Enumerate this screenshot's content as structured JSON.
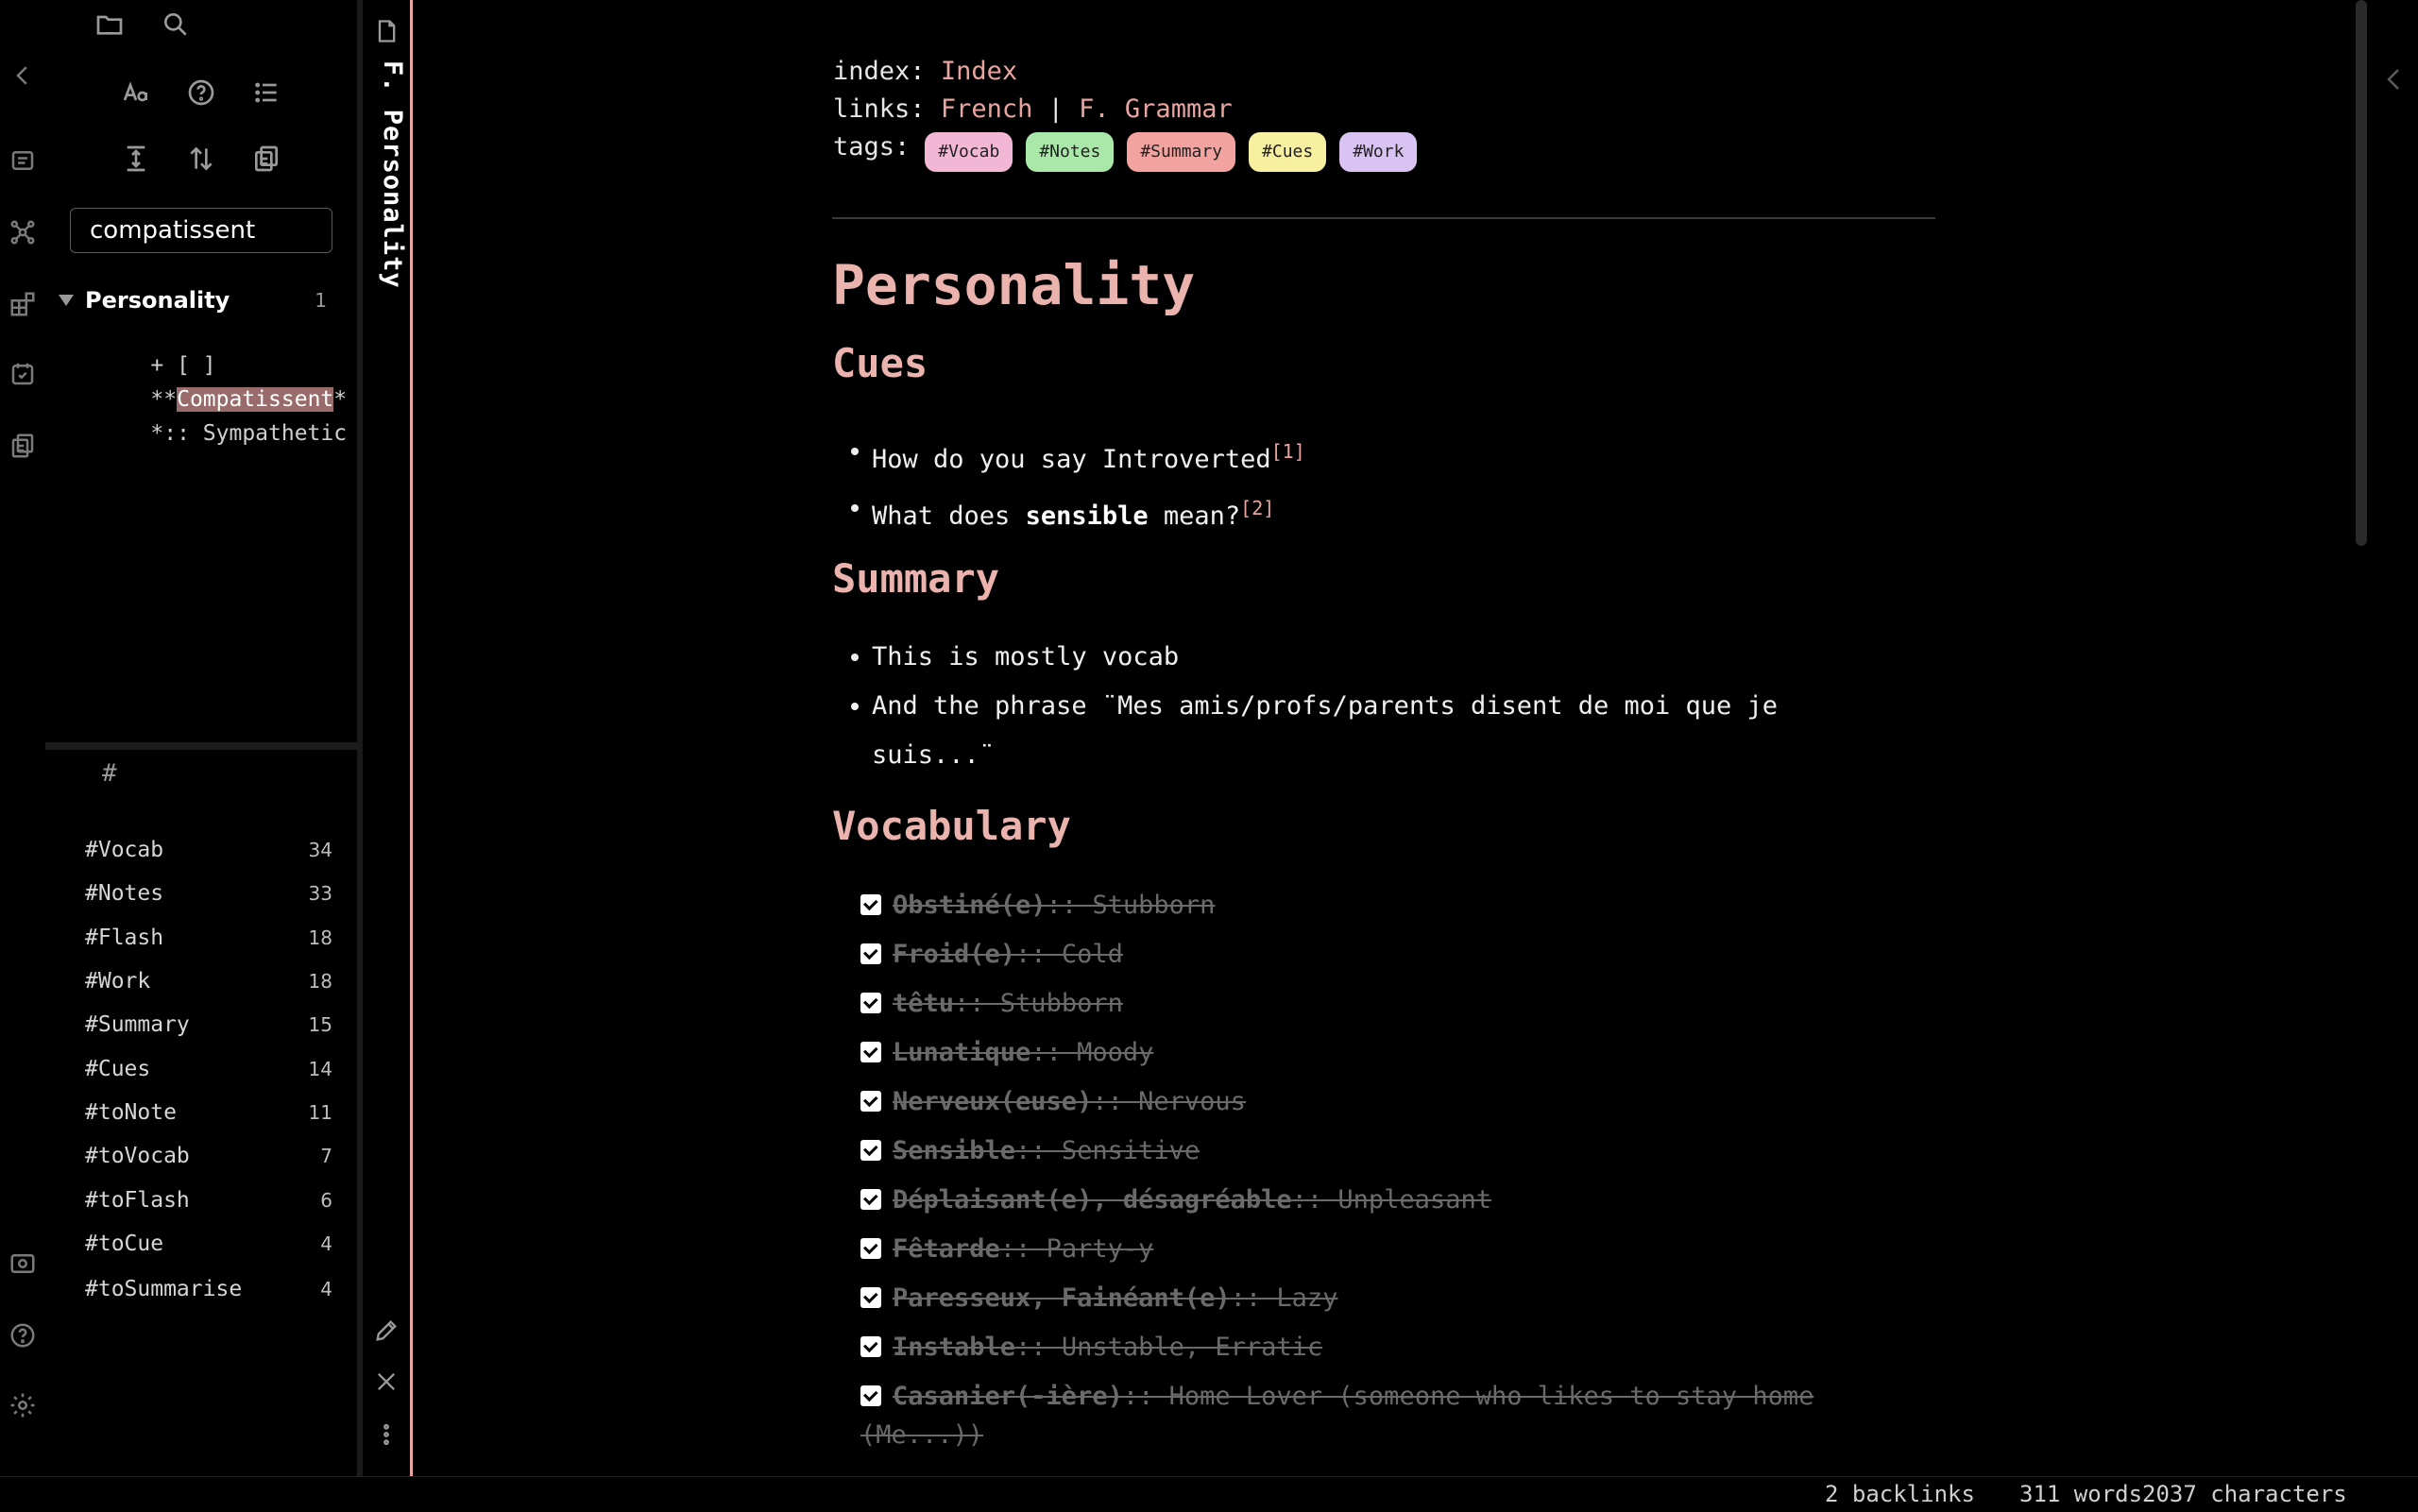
{
  "ribbon": {
    "icons": [
      "chevron-left-icon",
      "quick-switcher-icon",
      "graph-view-icon",
      "canvas-icon",
      "daily-note-icon",
      "templates-icon",
      "vault-icon",
      "help-icon",
      "settings-icon"
    ]
  },
  "sidebar": {
    "toolbar_icons": [
      "folder-icon",
      "search-icon",
      "match-case-icon",
      "help-icon",
      "list-icon",
      "expand-icon",
      "sort-icon",
      "copy-results-icon"
    ],
    "search": {
      "value": "compatissent"
    },
    "result": {
      "file": "Personality",
      "count": "1",
      "lines": [
        {
          "pre": "+ [ ]",
          "hl": "",
          "post": ""
        },
        {
          "pre": "**",
          "hl": "Compatissent",
          "post": "*"
        },
        {
          "pre": "*:: Sympathetic",
          "hl": "",
          "post": ""
        }
      ]
    },
    "tags_header": "#",
    "tags": [
      {
        "name": "#Vocab",
        "count": "34"
      },
      {
        "name": "#Notes",
        "count": "33"
      },
      {
        "name": "#Flash",
        "count": "18"
      },
      {
        "name": "#Work",
        "count": "18"
      },
      {
        "name": "#Summary",
        "count": "15"
      },
      {
        "name": "#Cues",
        "count": "14"
      },
      {
        "name": "#toNote",
        "count": "11"
      },
      {
        "name": "#toVocab",
        "count": "7"
      },
      {
        "name": "#toFlash",
        "count": "6"
      },
      {
        "name": "#toCue",
        "count": "4"
      },
      {
        "name": "#toSummarise",
        "count": "4"
      }
    ]
  },
  "tab": {
    "title": "F. Personality"
  },
  "frontmatter": {
    "index_label": "index:",
    "index_value": "Index",
    "links_label": "links:",
    "links": [
      "French",
      "F. Grammar"
    ],
    "links_sep": "|",
    "tags_label": "tags:",
    "tags": [
      {
        "label": "#Vocab",
        "color": "#f3b7d6"
      },
      {
        "label": "#Notes",
        "color": "#a9e8a8"
      },
      {
        "label": "#Summary",
        "color": "#f2a3a0"
      },
      {
        "label": "#Cues",
        "color": "#f6f0a0"
      },
      {
        "label": "#Work",
        "color": "#d9c3f3"
      }
    ]
  },
  "note": {
    "title": "Personality",
    "cues_heading": "Cues",
    "cues": [
      {
        "pre": "How do you say Introverted",
        "bold": "",
        "post": "",
        "ref": "[1]"
      },
      {
        "pre": "What does ",
        "bold": "sensible",
        "post": " mean?",
        "ref": "[2]"
      }
    ],
    "summary_heading": "Summary",
    "summary": [
      "This is mostly vocab",
      "And the phrase ¨Mes amis/profs/parents disent de moi que je",
      "suis...¨"
    ],
    "vocab_heading": "Vocabulary",
    "vocab": [
      {
        "term": "Obstiné(e)",
        "def": ":: Stubborn"
      },
      {
        "term": "Froid(e)",
        "def": ":: Cold"
      },
      {
        "term": "têtu",
        "def": ":: Stubborn"
      },
      {
        "term": "Lunatique",
        "def": ":: Moody"
      },
      {
        "term": "Nerveux(euse)",
        "def": ":: Nervous"
      },
      {
        "term": "Sensible",
        "def": ":: Sensitive"
      },
      {
        "term": "Déplaisant(e), désagréable",
        "def": ":: Unpleasant"
      },
      {
        "term": "Fêtarde",
        "def": ":: Party-y"
      },
      {
        "term": "Paresseux, Fainéant(e)",
        "def": ":: Lazy"
      },
      {
        "term": "Instable",
        "def": ":: Unstable, Erratic"
      },
      {
        "term": "Casanier(-ière)",
        "def": ":: Home Lover (someone who likes to stay home"
      }
    ],
    "vocab_wrap": "(Me...))"
  },
  "status": {
    "backlinks": "2 backlinks",
    "words": "311 words",
    "chars": "2037 characters"
  },
  "colors": {
    "accent": "#e8a4a0",
    "heading": "#ebb3ad",
    "highlight": "#9a6b6b"
  }
}
